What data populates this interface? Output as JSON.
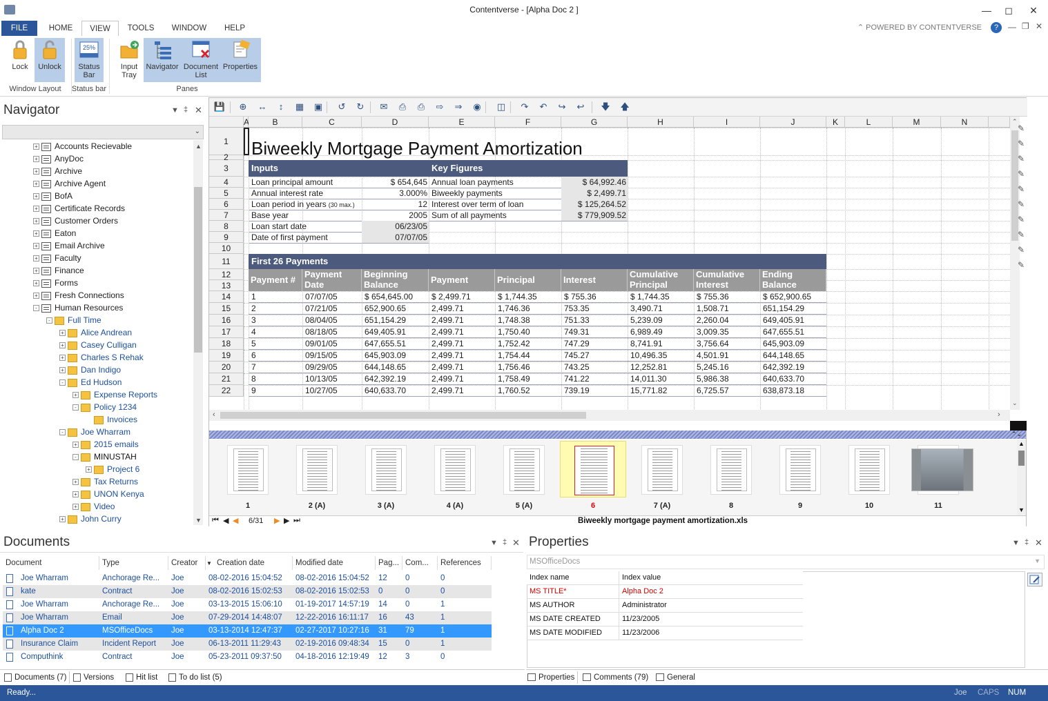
{
  "window": {
    "title": "Contentverse - [Alpha Doc 2 ]"
  },
  "menubar": {
    "file": "FILE",
    "home": "HOME",
    "view": "VIEW",
    "tools": "TOOLS",
    "window": "WINDOW",
    "help": "HELP",
    "powered": "POWERED BY CONTENTVERSE"
  },
  "ribbon": {
    "lock": "Lock",
    "unlock": "Unlock",
    "status_bar_1": "Status",
    "status_bar_2": "Bar",
    "input_tray_1": "Input",
    "input_tray_2": "Tray",
    "navigator": "Navigator",
    "document_list_1": "Document",
    "document_list_2": "List",
    "properties": "Properties",
    "group_window_layout": "Window Layout",
    "group_status_bar": "Status bar",
    "group_panes": "Panes",
    "status_icon_text": "25%"
  },
  "navigator": {
    "title": "Navigator",
    "items": [
      {
        "label": "Accounts Recievable"
      },
      {
        "label": "AnyDoc"
      },
      {
        "label": "Archive"
      },
      {
        "label": "Archive Agent"
      },
      {
        "label": "BofA"
      },
      {
        "label": "Certificate Records"
      },
      {
        "label": "Customer Orders"
      },
      {
        "label": "Eaton"
      },
      {
        "label": "Email Archive"
      },
      {
        "label": "Faculty"
      },
      {
        "label": "Finance"
      },
      {
        "label": "Forms"
      },
      {
        "label": "Fresh Connections"
      },
      {
        "label": "Human Resources"
      },
      {
        "label": "Full Time"
      },
      {
        "label": "Alice Andrean"
      },
      {
        "label": "Casey Culligan"
      },
      {
        "label": "Charles S Rehak"
      },
      {
        "label": "Dan Indigo"
      },
      {
        "label": "Ed Hudson"
      },
      {
        "label": "Expense Reports"
      },
      {
        "label": "Policy 1234"
      },
      {
        "label": "Invoices"
      },
      {
        "label": "Joe Wharram"
      },
      {
        "label": "2015 emails"
      },
      {
        "label": "MINUSTAH"
      },
      {
        "label": "Project 6"
      },
      {
        "label": "Tax Returns"
      },
      {
        "label": "UNON Kenya"
      },
      {
        "label": "Video"
      },
      {
        "label": "John Curry"
      }
    ]
  },
  "sheet": {
    "title": "Biweekly Mortgage Payment Amortization",
    "columns": [
      "A",
      "B",
      "C",
      "D",
      "E",
      "F",
      "G",
      "H",
      "I",
      "J",
      "K",
      "L",
      "M",
      "N"
    ],
    "rows": [
      "1",
      "2",
      "3",
      "4",
      "5",
      "6",
      "7",
      "8",
      "9",
      "10",
      "11",
      "12",
      "13",
      "14",
      "15",
      "16",
      "17",
      "18",
      "19",
      "20",
      "21",
      "22"
    ],
    "inputs_label": "Inputs",
    "key_figures_label": "Key Figures",
    "inputs": [
      {
        "label": "Loan principal amount",
        "value": "$ 654,645"
      },
      {
        "label": "Annual interest rate",
        "value": "3.000%"
      },
      {
        "label": "Loan period in years",
        "note": "(30 max.)",
        "value": "12"
      },
      {
        "label": "Base year",
        "value": "2005"
      },
      {
        "label": "Loan start date",
        "value": "06/23/05"
      },
      {
        "label": "Date of first payment",
        "value": "07/07/05"
      }
    ],
    "key_figures": [
      {
        "label": "Annual loan payments",
        "value": "$ 64,992.46"
      },
      {
        "label": "Biweekly payments",
        "value": "$ 2,499.71"
      },
      {
        "label": "Interest over term of loan",
        "value": "$ 125,264.52"
      },
      {
        "label": "Sum of all payments",
        "value": "$ 779,909.52"
      }
    ],
    "first26_label": "First 26 Payments",
    "table_headers": [
      [
        "Payment #",
        ""
      ],
      [
        "Payment",
        "Date"
      ],
      [
        "Beginning",
        "Balance"
      ],
      [
        "Payment",
        ""
      ],
      [
        "Principal",
        ""
      ],
      [
        "Interest",
        ""
      ],
      [
        "Cumulative",
        "Principal"
      ],
      [
        "Cumulative",
        "Interest"
      ],
      [
        "Ending",
        "Balance"
      ]
    ],
    "payments": [
      [
        "1",
        "07/07/05",
        "$ 654,645.00",
        "$ 2,499.71",
        "$ 1,744.35",
        "$ 755.36",
        "$ 1,744.35",
        "$ 755.36",
        "$ 652,900.65"
      ],
      [
        "2",
        "07/21/05",
        "652,900.65",
        "2,499.71",
        "1,746.36",
        "753.35",
        "3,490.71",
        "1,508.71",
        "651,154.29"
      ],
      [
        "3",
        "08/04/05",
        "651,154.29",
        "2,499.71",
        "1,748.38",
        "751.33",
        "5,239.09",
        "2,260.04",
        "649,405.91"
      ],
      [
        "4",
        "08/18/05",
        "649,405.91",
        "2,499.71",
        "1,750.40",
        "749.31",
        "6,989.49",
        "3,009.35",
        "647,655.51"
      ],
      [
        "5",
        "09/01/05",
        "647,655.51",
        "2,499.71",
        "1,752.42",
        "747.29",
        "8,741.91",
        "3,756.64",
        "645,903.09"
      ],
      [
        "6",
        "09/15/05",
        "645,903.09",
        "2,499.71",
        "1,754.44",
        "745.27",
        "10,496.35",
        "4,501.91",
        "644,148.65"
      ],
      [
        "7",
        "09/29/05",
        "644,148.65",
        "2,499.71",
        "1,756.46",
        "743.25",
        "12,252.81",
        "5,245.16",
        "642,392.19"
      ],
      [
        "8",
        "10/13/05",
        "642,392.19",
        "2,499.71",
        "1,758.49",
        "741.22",
        "14,011.30",
        "5,986.38",
        "640,633.70"
      ],
      [
        "9",
        "10/27/05",
        "640,633.70",
        "2,499.71",
        "1,760.52",
        "739.19",
        "15,771.82",
        "6,725.57",
        "638,873.18"
      ]
    ]
  },
  "thumbnails": {
    "labels": [
      "1",
      "2 (A)",
      "3 (A)",
      "4 (A)",
      "5 (A)",
      "6",
      "7 (A)",
      "8",
      "9",
      "10",
      "11"
    ],
    "selected": "6",
    "page": "6/31",
    "filename": "Biweekly mortgage payment amortization.xls"
  },
  "documents": {
    "title": "Documents",
    "headers": [
      "Document",
      "Type",
      "Creator",
      "Creation date",
      "Modified date",
      "Pag...",
      "Com...",
      "References"
    ],
    "rows": [
      [
        "Joe Wharram",
        "Anchorage Re...",
        "Joe",
        "08-02-2016 15:04:52",
        "08-02-2016 15:04:52",
        "12",
        "0",
        "0"
      ],
      [
        "kate",
        "Contract",
        "Joe",
        "08-02-2016 15:02:53",
        "08-02-2016 15:02:53",
        "0",
        "0",
        "0"
      ],
      [
        "Joe Wharram",
        "Anchorage Re...",
        "Joe",
        "03-13-2015 15:06:10",
        "01-19-2017 14:57:19",
        "14",
        "0",
        "1"
      ],
      [
        "Joe Wharram",
        "Email",
        "Joe",
        "07-29-2014 14:48:07",
        "12-22-2016 16:11:17",
        "16",
        "43",
        "1"
      ],
      [
        "Alpha Doc 2",
        "MSOfficeDocs",
        "Joe",
        "03-13-2014 12:47:37",
        "02-27-2017 10:27:16",
        "31",
        "79",
        "1"
      ],
      [
        "Insurance Claim",
        "Incident Report",
        "Joe",
        "06-13-2011 11:29:43",
        "02-19-2016 09:48:34",
        "15",
        "0",
        "1"
      ],
      [
        "Computhink",
        "Contract",
        "Joe",
        "05-23-2011 09:37:50",
        "04-18-2016 12:19:49",
        "12",
        "3",
        "0"
      ]
    ],
    "tabs": [
      "Documents (7)",
      "Versions",
      "Hit list",
      "To do list (5)"
    ]
  },
  "properties": {
    "title": "Properties",
    "doctype": "MSOfficeDocs",
    "col_name": "Index name",
    "col_value": "Index value",
    "rows": [
      [
        "MS TITLE*",
        "Alpha Doc 2"
      ],
      [
        "MS AUTHOR",
        "Administrator"
      ],
      [
        "MS DATE CREATED",
        "11/23/2005"
      ],
      [
        "MS DATE MODIFIED",
        "11/23/2006"
      ]
    ],
    "tabs": [
      "Properties",
      "Comments (79)",
      "General"
    ]
  },
  "status": {
    "text": "Ready...",
    "user": "Joe",
    "caps": "CAPS",
    "num": "NUM"
  },
  "colors": {
    "accent": "#2b579a",
    "header_bar": "#4b5a7d",
    "table_header": "#9a9a9a",
    "selection": "#3399ff",
    "required": "#d00000"
  }
}
